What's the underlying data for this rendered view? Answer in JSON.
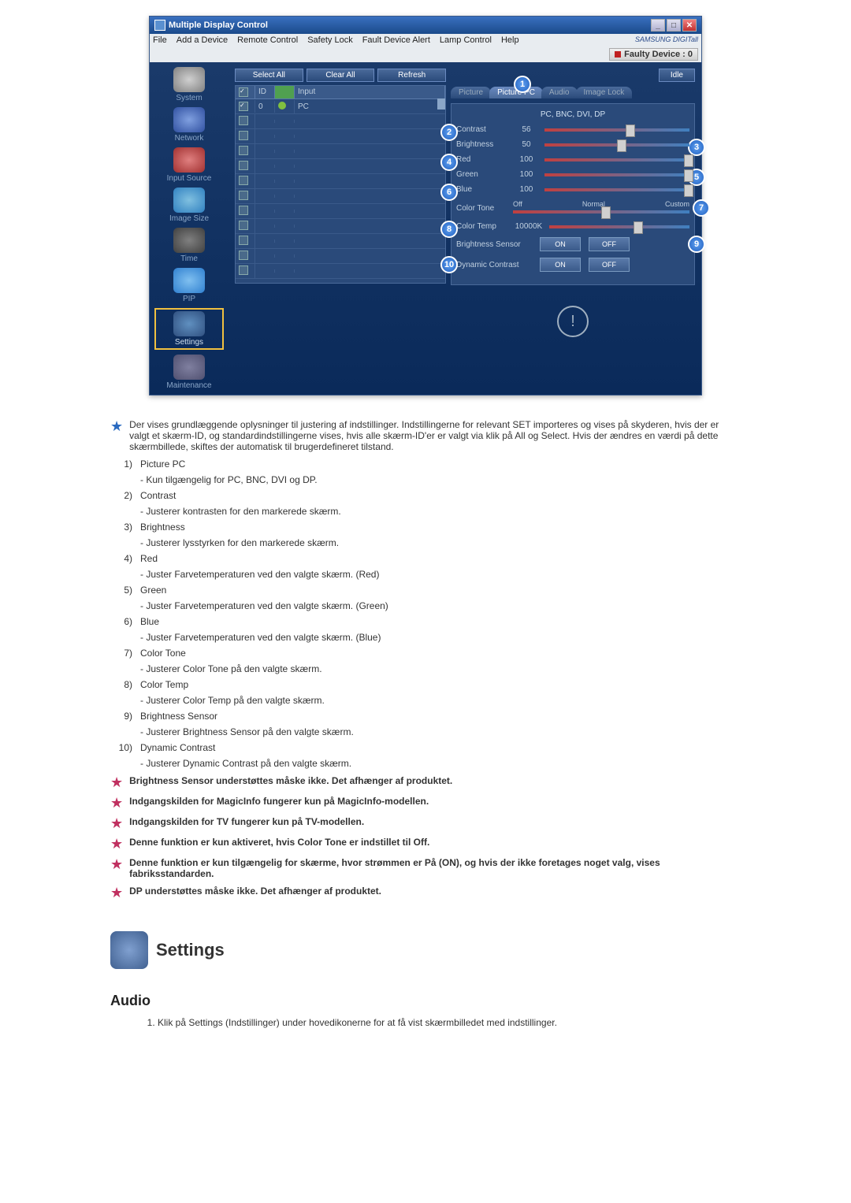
{
  "titlebar": {
    "title": "Multiple Display Control"
  },
  "menu": {
    "file": "File",
    "add": "Add a Device",
    "remote": "Remote Control",
    "safety": "Safety Lock",
    "fault": "Fault Device Alert",
    "lamp": "Lamp Control",
    "help": "Help",
    "logo": "SAMSUNG DIGITall"
  },
  "faulty": {
    "label": "Faulty Device : 0"
  },
  "list_buttons": {
    "select": "Select All",
    "clear": "Clear All",
    "refresh": "Refresh"
  },
  "idle": "Idle",
  "grid": {
    "head_id": "ID",
    "head_input": "Input",
    "row0_id": "0",
    "row0_input": "PC"
  },
  "sidebar": {
    "system": "System",
    "network": "Network",
    "input": "Input Source",
    "size": "Image Size",
    "time": "Time",
    "pip": "PIP",
    "settings": "Settings",
    "maintenance": "Maintenance"
  },
  "tabs": {
    "picture": "Picture",
    "picturepc": "Picture PC",
    "audio": "Audio",
    "imagelock": "Image Lock"
  },
  "panel_head": "PC, BNC, DVI, DP",
  "ctrl": {
    "contrast": "Contrast",
    "contrast_v": "56",
    "brightness": "Brightness",
    "brightness_v": "50",
    "red": "Red",
    "red_v": "100",
    "green": "Green",
    "green_v": "100",
    "blue": "Blue",
    "blue_v": "100",
    "colortone": "Color Tone",
    "off": "Off",
    "normal": "Normal",
    "custom": "Custom",
    "colortemp": "Color Temp",
    "colortemp_v": "10000K",
    "bsensor": "Brightness Sensor",
    "on": "ON",
    "offbtn": "OFF",
    "dcontrast": "Dynamic Contrast"
  },
  "callout": {
    "c1": "1",
    "c2": "2",
    "c3": "3",
    "c4": "4",
    "c5": "5",
    "c6": "6",
    "c7": "7",
    "c8": "8",
    "c9": "9",
    "c10": "10"
  },
  "doc": {
    "intro": "Der vises grundlæggende oplysninger til justering af indstillinger. Indstillingerne for relevant SET importeres og vises på skyderen, hvis der er valgt et skærm-ID, og standardindstillingerne vises, hvis alle skærm-ID'er er valgt via klik på All og Select. Hvis der ændres en værdi på dette skærmbillede, skiftes der automatisk til brugerdefineret tilstand.",
    "n1": "1)",
    "t1": "Picture PC",
    "s1": "- Kun tilgængelig for PC, BNC, DVI og DP.",
    "n2": "2)",
    "t2": "Contrast",
    "s2": "- Justerer kontrasten for den markerede skærm.",
    "n3": "3)",
    "t3": "Brightness",
    "s3": "- Justerer lysstyrken for den markerede skærm.",
    "n4": "4)",
    "t4": "Red",
    "s4": "- Juster Farvetemperaturen ved den valgte skærm. (Red)",
    "n5": "5)",
    "t5": "Green",
    "s5": "- Juster Farvetemperaturen ved den valgte skærm. (Green)",
    "n6": "6)",
    "t6": "Blue",
    "s6": "- Juster Farvetemperaturen ved den valgte skærm. (Blue)",
    "n7": "7)",
    "t7": "Color Tone",
    "s7": "- Justerer Color Tone på den valgte skærm.",
    "n8": "8)",
    "t8": "Color Temp",
    "s8": "- Justerer Color Temp på den valgte skærm.",
    "n9": "9)",
    "t9": "Brightness Sensor",
    "s9": "- Justerer Brightness Sensor på den valgte skærm.",
    "n10": "10)",
    "t10": "Dynamic Contrast",
    "s10": "- Justerer Dynamic Contrast på den valgte skærm.",
    "note1": "Brightness Sensor understøttes måske ikke. Det afhænger af produktet.",
    "note2": "Indgangskilden for MagicInfo fungerer kun på MagicInfo-modellen.",
    "note3": "Indgangskilden for TV fungerer kun på TV-modellen.",
    "note4": "Denne funktion er kun aktiveret, hvis Color Tone er indstillet til Off.",
    "note5": "Denne funktion er kun tilgængelig for skærme, hvor strømmen er På (ON), og hvis der ikke foretages noget valg, vises fabriksstandarden.",
    "note6": "DP understøttes måske ikke. Det afhænger af produktet.",
    "section_title": "Settings",
    "audio_title": "Audio",
    "audio_step": "Klik på Settings (Indstillinger) under hovedikonerne for at få vist skærmbilledet med indstillinger."
  }
}
